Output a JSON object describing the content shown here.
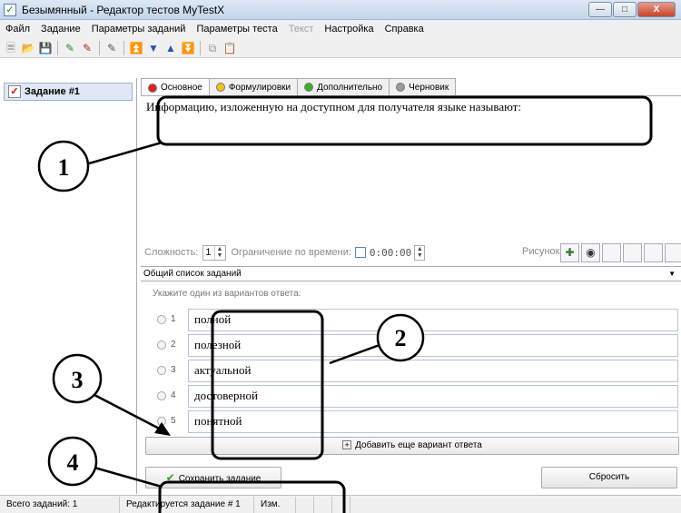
{
  "window": {
    "title": "Безымянный - Редактор тестов MyTestX",
    "app_icon": "checkbox-icon",
    "buttons": [
      "minimize-icon",
      "maximize-icon",
      "close-icon"
    ]
  },
  "menu": {
    "items": [
      {
        "label": "Файл",
        "enabled": true
      },
      {
        "label": "Задание",
        "enabled": true
      },
      {
        "label": "Параметры заданий",
        "enabled": true
      },
      {
        "label": "Параметры теста",
        "enabled": true
      },
      {
        "label": "Текст",
        "enabled": false
      },
      {
        "label": "Настройка",
        "enabled": true
      },
      {
        "label": "Справка",
        "enabled": true
      }
    ]
  },
  "toolbar": {
    "icons": [
      "new-file-icon",
      "open-folder-icon",
      "save-icon",
      "add-task-icon",
      "delete-task-icon",
      "task-icon",
      "first-icon",
      "down-icon",
      "up-icon",
      "last-icon",
      "copy-icon",
      "paste-icon"
    ]
  },
  "tasks": {
    "items": [
      {
        "label": "Задание #1",
        "icon": "task-check-icon"
      }
    ]
  },
  "tabs": [
    {
      "label": "Основное",
      "color": "#e02020",
      "active": true
    },
    {
      "label": "Формулировки",
      "color": "#f2c21a",
      "active": false
    },
    {
      "label": "Дополнительно",
      "color": "#39b22a",
      "active": false
    },
    {
      "label": "Черновик",
      "color": "#9a9a9a",
      "active": false
    }
  ],
  "question": {
    "text": "Информацию, изложенную на доступном для получателя языке называют:"
  },
  "params": {
    "difficulty_label": "Сложность:",
    "difficulty_value": "1",
    "time_limit_label": "Ограничение по времени:",
    "time_limit_enabled": false,
    "time_value": "0:00:00",
    "picture_label": "Рисунок:"
  },
  "task_list": {
    "selected": "Общий список заданий"
  },
  "answers": {
    "hint": "Укажите один из вариантов ответа:",
    "items": [
      {
        "number": "1",
        "text": "полной"
      },
      {
        "number": "2",
        "text": "полезной"
      },
      {
        "number": "3",
        "text": "актуальной"
      },
      {
        "number": "4",
        "text": "достоверной"
      },
      {
        "number": "5",
        "text": "понятной"
      }
    ],
    "add_label": "Добавить еще вариант ответа"
  },
  "actions": {
    "save_label": "Сохранить задание",
    "reset_label": "Сбросить"
  },
  "status": {
    "total": "Всего заданий: 1",
    "editing": "Редактируется задание # 1",
    "modified": "Изм."
  },
  "annotations": {
    "labels": [
      "1",
      "2",
      "3",
      "4"
    ]
  }
}
